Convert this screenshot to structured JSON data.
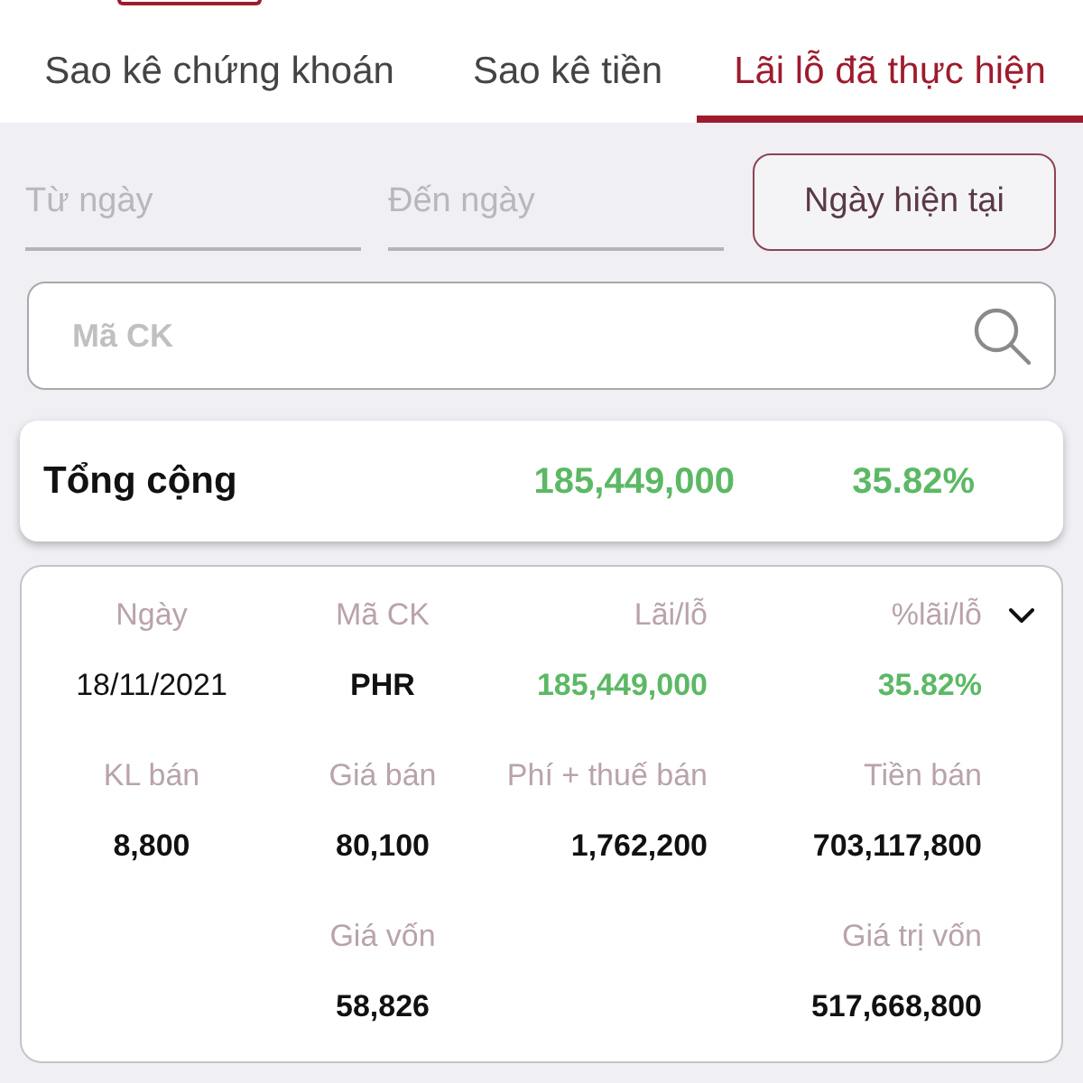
{
  "tabs": [
    {
      "label": "Sao kê chứng khoán",
      "selected": false
    },
    {
      "label": "Sao kê tiền",
      "selected": false
    },
    {
      "label": "Lãi lỗ đã thực hiện",
      "selected": true
    }
  ],
  "date_filter": {
    "from": {
      "placeholder": "Từ ngày"
    },
    "to": {
      "placeholder": "Đến ngày"
    },
    "button": "Ngày hiện tại"
  },
  "search": {
    "placeholder": "Mã CK"
  },
  "total": {
    "label": "Tổng cộng",
    "profit": "185,449,000",
    "percent": "35.82%"
  },
  "records": [
    {
      "rows": [
        [
          {
            "label": "Ngày",
            "value": "18/11/2021",
            "kind": "plain"
          },
          {
            "label": "Mã CK",
            "value": "PHR",
            "kind": "bold"
          },
          {
            "label": "Lãi/lỗ",
            "value": "185,449,000",
            "kind": "gain"
          },
          {
            "label": "%lãi/lỗ",
            "value": "35.82%",
            "kind": "gain"
          }
        ],
        [
          {
            "label": "KL bán",
            "value": "8,800",
            "kind": "bold"
          },
          {
            "label": "Giá bán",
            "value": "80,100",
            "kind": "bold"
          },
          {
            "label": "Phí + thuế bán",
            "value": "1,762,200",
            "kind": "bold"
          },
          {
            "label": "Tiền bán",
            "value": "703,117,800",
            "kind": "bold"
          }
        ],
        [
          null,
          {
            "label": "Giá vốn",
            "value": "58,826",
            "kind": "bold"
          },
          null,
          {
            "label": "Giá trị vốn",
            "value": "517,668,800",
            "kind": "bold"
          }
        ]
      ]
    }
  ]
}
